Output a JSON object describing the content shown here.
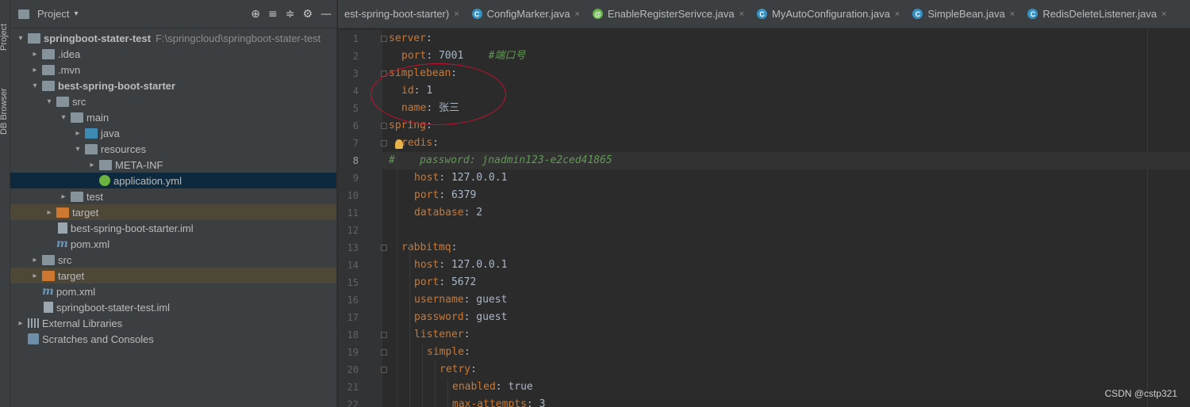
{
  "side_strip": {
    "project_label": "Project",
    "db_label": "DB Browser"
  },
  "project_panel": {
    "title": "Project",
    "items": [
      {
        "name": "springboot-stater-test",
        "path": "F:\\springcloud\\springboot-stater-test",
        "kind": "folder",
        "bold": true,
        "arrow": "▾",
        "depth": 0
      },
      {
        "name": ".idea",
        "kind": "folder",
        "arrow": "▸",
        "depth": 1
      },
      {
        "name": ".mvn",
        "kind": "folder",
        "arrow": "▸",
        "depth": 1
      },
      {
        "name": "best-spring-boot-starter",
        "kind": "folder",
        "bold": true,
        "arrow": "▾",
        "depth": 1
      },
      {
        "name": "src",
        "kind": "folder",
        "arrow": "▾",
        "depth": 2
      },
      {
        "name": "main",
        "kind": "folder",
        "arrow": "▾",
        "depth": 3
      },
      {
        "name": "java",
        "kind": "folder-blue",
        "arrow": "▸",
        "depth": 4
      },
      {
        "name": "resources",
        "kind": "folder",
        "arrow": "▾",
        "depth": 4
      },
      {
        "name": "META-INF",
        "kind": "folder",
        "arrow": "▸",
        "depth": 5
      },
      {
        "name": "application.yml",
        "kind": "spring",
        "arrow": "",
        "depth": 5,
        "selected": true
      },
      {
        "name": "test",
        "kind": "folder",
        "arrow": "▸",
        "depth": 3
      },
      {
        "name": "target",
        "kind": "folder-orange",
        "arrow": "▸",
        "depth": 2,
        "excluded": true
      },
      {
        "name": "best-spring-boot-starter.iml",
        "kind": "file",
        "arrow": "",
        "depth": 2
      },
      {
        "name": "pom.xml",
        "kind": "maven",
        "arrow": "",
        "depth": 2
      },
      {
        "name": "src",
        "kind": "folder",
        "arrow": "▸",
        "depth": 1
      },
      {
        "name": "target",
        "kind": "folder-orange",
        "arrow": "▸",
        "depth": 1,
        "excluded": true
      },
      {
        "name": "pom.xml",
        "kind": "maven",
        "arrow": "",
        "depth": 1
      },
      {
        "name": "springboot-stater-test.iml",
        "kind": "file",
        "arrow": "",
        "depth": 1
      },
      {
        "name": "External Libraries",
        "kind": "lib",
        "arrow": "▸",
        "depth": 0
      },
      {
        "name": "Scratches and Consoles",
        "kind": "scratch",
        "arrow": "",
        "depth": 0
      }
    ]
  },
  "tabs": [
    {
      "label": "est-spring-boot-starter)",
      "icon": "",
      "close": "×"
    },
    {
      "label": "ConfigMarker.java",
      "icon": "C",
      "close": "×"
    },
    {
      "label": "EnableRegisterSerivce.java",
      "icon": "@",
      "close": "×"
    },
    {
      "label": "MyAutoConfiguration.java",
      "icon": "C",
      "close": "×"
    },
    {
      "label": "SimpleBean.java",
      "icon": "C",
      "close": "×"
    },
    {
      "label": "RedisDeleteListener.java",
      "icon": "C",
      "close": "×"
    }
  ],
  "editor": {
    "current_line": 8,
    "lines": [
      {
        "n": "1",
        "indent": 0,
        "key": "server",
        "sep": ":",
        "val": ""
      },
      {
        "n": "2",
        "indent": 1,
        "key": "port",
        "sep": ": ",
        "val": "7001",
        "comment": "    #端口号"
      },
      {
        "n": "3",
        "indent": 0,
        "key": "simplebean",
        "sep": ":",
        "val": ""
      },
      {
        "n": "4",
        "indent": 1,
        "key": "id",
        "sep": ": ",
        "val": "1"
      },
      {
        "n": "5",
        "indent": 1,
        "key": "name",
        "sep": ": ",
        "val": "张三"
      },
      {
        "n": "6",
        "indent": 0,
        "key": "spring",
        "sep": ":",
        "val": ""
      },
      {
        "n": "7",
        "indent": 1,
        "key": "redis",
        "sep": ":",
        "val": ""
      },
      {
        "n": "8",
        "indent": 0,
        "key": "",
        "sep": "",
        "val": "",
        "comment": "#    password: jnadmin123-e2ced41865"
      },
      {
        "n": "9",
        "indent": 2,
        "key": "host",
        "sep": ": ",
        "val": "127.0.0.1"
      },
      {
        "n": "10",
        "indent": 2,
        "key": "port",
        "sep": ": ",
        "val": "6379"
      },
      {
        "n": "11",
        "indent": 2,
        "key": "database",
        "sep": ": ",
        "val": "2"
      },
      {
        "n": "12",
        "indent": 0,
        "key": "",
        "sep": "",
        "val": ""
      },
      {
        "n": "13",
        "indent": 1,
        "key": "rabbitmq",
        "sep": ":",
        "val": ""
      },
      {
        "n": "14",
        "indent": 2,
        "key": "host",
        "sep": ": ",
        "val": "127.0.0.1"
      },
      {
        "n": "15",
        "indent": 2,
        "key": "port",
        "sep": ": ",
        "val": "5672"
      },
      {
        "n": "16",
        "indent": 2,
        "key": "username",
        "sep": ": ",
        "val": "guest"
      },
      {
        "n": "17",
        "indent": 2,
        "key": "password",
        "sep": ": ",
        "val": "guest"
      },
      {
        "n": "18",
        "indent": 2,
        "key": "listener",
        "sep": ":",
        "val": ""
      },
      {
        "n": "19",
        "indent": 3,
        "key": "simple",
        "sep": ":",
        "val": ""
      },
      {
        "n": "20",
        "indent": 4,
        "key": "retry",
        "sep": ":",
        "val": ""
      },
      {
        "n": "21",
        "indent": 5,
        "key": "enabled",
        "sep": ": ",
        "val": "true"
      },
      {
        "n": "22",
        "indent": 5,
        "key": "max-attempts",
        "sep": ": ",
        "val": "3"
      }
    ]
  },
  "watermark": "CSDN @cstp321",
  "colors": {
    "key": "#cc7832",
    "value": "#a9b7c6",
    "comment": "#629755",
    "annotation": "#c8102e"
  }
}
